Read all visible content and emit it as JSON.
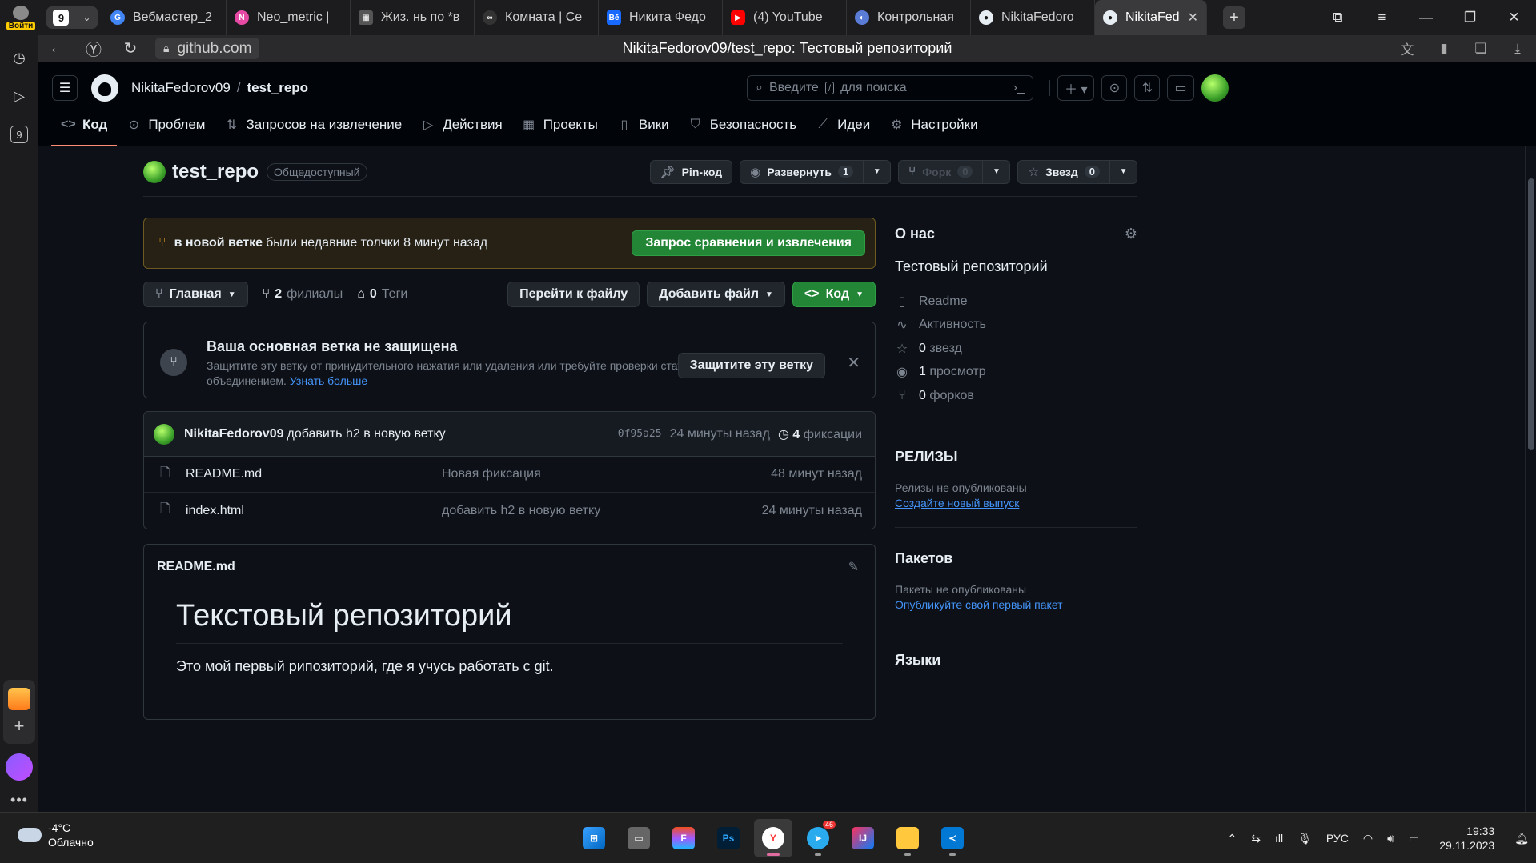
{
  "browser": {
    "login_label": "Войти",
    "tab_count": "9",
    "tabs": [
      {
        "title": "Вебмастер_2",
        "color": "#4285f4",
        "icon": "G"
      },
      {
        "title": "Neo_metric |",
        "color": "#e64aa5",
        "icon": "N"
      },
      {
        "title": "Жиз. нь по *в",
        "color": "#444444",
        "icon": "Ж"
      },
      {
        "title": "Комната | Се",
        "color": "#333333",
        "icon": "К"
      },
      {
        "title": "Никита Федо",
        "color": "#1769ff",
        "icon": "Bē"
      },
      {
        "title": "(4) YouTube",
        "color": "#ff0000",
        "icon": "▶"
      },
      {
        "title": "Контрольная",
        "color": "#5b7cd6",
        "icon": "К"
      },
      {
        "title": "NikitaFedoro",
        "color": "#24292f",
        "icon": "●"
      },
      {
        "title": "NikitaFedo",
        "color": "#24292f",
        "icon": "●"
      }
    ],
    "url": "github.com",
    "page_title": "NikitaFedorov09/test_repo: Тестовый репозиторий",
    "rail_badge": "9"
  },
  "gh": {
    "owner": "NikitaFedorov09",
    "repo": "test_repo",
    "search_placeholder_pre": "Введите",
    "search_key": "/",
    "search_placeholder_post": "для поиска",
    "nav": [
      "Код",
      "Проблем",
      "Запросов на извлечение",
      "Действия",
      "Проекты",
      "Вики",
      "Безопасность",
      "Идеи",
      "Настройки"
    ],
    "visibility": "Общедоступный",
    "pin_label": "Pin-код",
    "watch_label": "Развернуть",
    "watch_count": "1",
    "fork_label": "Форк",
    "fork_count": "0",
    "star_label": "Звезд",
    "star_count": "0",
    "push_branch": "в новой ветке",
    "push_text": "были недавние толчки 8 минут назад",
    "compare_btn": "Запрос сравнения и извлечения",
    "branch_btn": "Главная",
    "branches_count": "2",
    "branches_label": "филиалы",
    "tags_count": "0",
    "tags_label": "Теги",
    "goto_file": "Перейти к файлу",
    "add_file": "Добавить файл",
    "code_btn": "Код",
    "protect_title": "Ваша основная ветка не защищена",
    "protect_desc": "Защитите эту ветку от принудительного нажатия или удаления или требуйте проверки статуса перед объединением.",
    "protect_link": "Узнать больше",
    "protect_btn": "Защитите эту ветку",
    "commit_author": "NikitaFedorov09",
    "commit_msg": "добавить h2 в новую ветку",
    "commit_sha": "0f95a25",
    "commit_time": "24 минуты назад",
    "commit_count": "4",
    "commit_count_label": "фиксации",
    "files": [
      {
        "name": "README.md",
        "msg": "Новая фиксация",
        "date": "48 минут назад"
      },
      {
        "name": "index.html",
        "msg": "добавить h2 в новую ветку",
        "date": "24 минуты назад"
      }
    ],
    "readme_label": "README.md",
    "readme_h1": "Текстовый репозиторий",
    "readme_p": "Это мой первый рипозиторий, где я учусь работать с git.",
    "about_title": "О нас",
    "about_desc": "Тестовый репозиторий",
    "about_items": [
      {
        "icon": "book-icon",
        "text": "Readme",
        "num": ""
      },
      {
        "icon": "pulse-icon",
        "text": "Активность",
        "num": ""
      },
      {
        "icon": "star-icon",
        "text": "звезд",
        "num": "0"
      },
      {
        "icon": "eye-icon",
        "text": "просмотр",
        "num": "1"
      },
      {
        "icon": "fork-icon",
        "text": "форков",
        "num": "0"
      }
    ],
    "releases_title": "РЕЛИЗЫ",
    "releases_empty": "Релизы не опубликованы",
    "releases_link": "Создайте новый выпуск",
    "packages_title": "Пакетов",
    "packages_empty": "Пакеты не опубликованы",
    "packages_link": "Опубликуйте свой первый пакет",
    "languages_title": "Языки"
  },
  "taskbar": {
    "temp": "-4°C",
    "weather": "Облачно",
    "lang": "РУС",
    "time": "19:33",
    "date": "29.11.2023",
    "telegram_badge": "46"
  }
}
